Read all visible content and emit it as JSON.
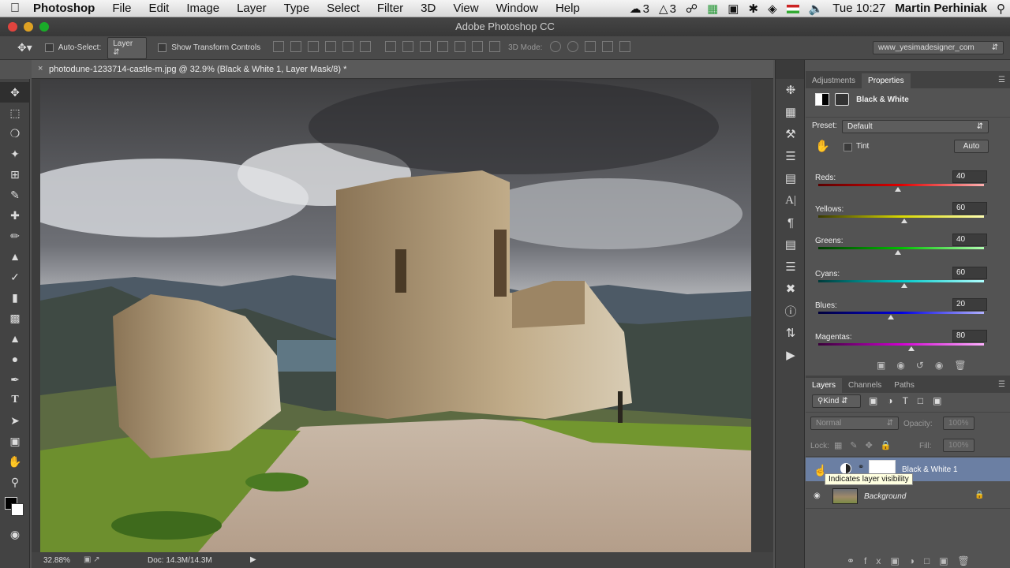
{
  "menubar": {
    "app": "Photoshop",
    "items": [
      "File",
      "Edit",
      "Image",
      "Layer",
      "Type",
      "Select",
      "Filter",
      "3D",
      "View",
      "Window",
      "Help"
    ],
    "status_cc": "3",
    "status_ai": "3",
    "clock": "Tue 10:27",
    "user": "Martin Perhiniak"
  },
  "window": {
    "title": "Adobe Photoshop CC"
  },
  "options": {
    "auto_select_label": "Auto-Select:",
    "auto_select_value": "Layer",
    "transform_label": "Show Transform Controls",
    "mode_3d_label": "3D Mode:",
    "workspace": "www_yesimadesigner_com"
  },
  "document": {
    "tab": "photodune-1233714-castle-m.jpg @ 32.9% (Black & White 1, Layer Mask/8) *",
    "zoom": "32.88%",
    "doc_size": "Doc: 14.3M/14.3M"
  },
  "properties": {
    "tabs": [
      "Adjustments",
      "Properties"
    ],
    "active_tab": "Properties",
    "title": "Black & White",
    "preset_label": "Preset:",
    "preset_value": "Default",
    "tint_label": "Tint",
    "auto_label": "Auto",
    "sliders": [
      {
        "name": "Reds",
        "label": "Reds:",
        "value": "40",
        "pos": 0.48,
        "gradient": "#5a0000,#e00000,#ffb0b0"
      },
      {
        "name": "Yellows",
        "label": "Yellows:",
        "value": "60",
        "pos": 0.52,
        "gradient": "#3a3a00,#d8d800,#ffffb0"
      },
      {
        "name": "Greens",
        "label": "Greens:",
        "value": "40",
        "pos": 0.48,
        "gradient": "#003a00,#00c000,#b0ffb0"
      },
      {
        "name": "Cyans",
        "label": "Cyans:",
        "value": "60",
        "pos": 0.52,
        "gradient": "#003a3a,#00c8c8,#b0ffff"
      },
      {
        "name": "Blues",
        "label": "Blues:",
        "value": "20",
        "pos": 0.44,
        "gradient": "#00003a,#0000e0,#b0b0ff"
      },
      {
        "name": "Magentas",
        "label": "Magentas:",
        "value": "80",
        "pos": 0.56,
        "gradient": "#3a003a,#d000d0,#ffb0ff"
      }
    ]
  },
  "layers": {
    "tabs": [
      "Layers",
      "Channels",
      "Paths"
    ],
    "active_tab": "Layers",
    "filter_kind": "Kind",
    "blend_mode": "Normal",
    "opacity_label": "Opacity:",
    "opacity_value": "100%",
    "lock_label": "Lock:",
    "fill_label": "Fill:",
    "fill_value": "100%",
    "items": [
      {
        "name": "Black & White 1",
        "selected": true
      },
      {
        "name": "Background",
        "selected": false
      }
    ],
    "tooltip": "Indicates layer visibility"
  },
  "colors": {
    "panel_bg": "#535353",
    "selected_layer": "#6b7fa3",
    "menubar_bg": "#e8e8e8"
  }
}
